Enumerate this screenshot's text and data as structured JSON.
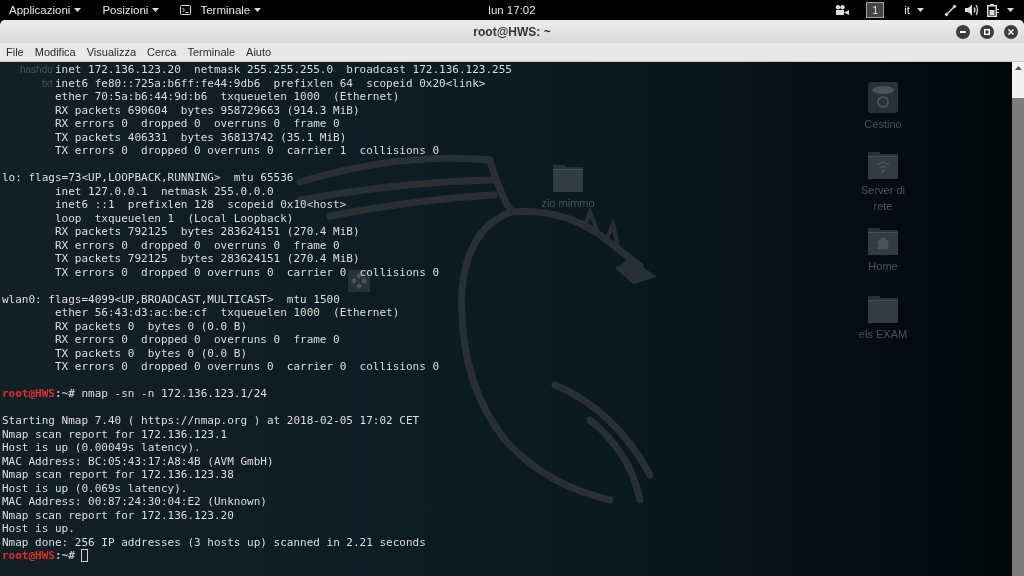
{
  "top_bar": {
    "menus": [
      {
        "kind": "menu",
        "label": "Applicazioni"
      },
      {
        "kind": "menu",
        "label": "Posizioni"
      },
      {
        "kind": "app",
        "label": "Terminale"
      }
    ],
    "clock": "lun 17:02",
    "workspace": "1",
    "keyboard_layout": "it"
  },
  "window": {
    "title": "root@HWS: ~"
  },
  "menu_bar": [
    "File",
    "Modifica",
    "Visualizza",
    "Cerca",
    "Terminale",
    "Aiuto"
  ],
  "desktop": {
    "icons": [
      {
        "kind": "label",
        "label": "hashdu"
      },
      {
        "kind": "label",
        "label": "txt"
      },
      {
        "kind": "app"
      },
      {
        "kind": "folder",
        "label": "zio mimmo"
      },
      {
        "kind": "trash",
        "label": "Cestino"
      },
      {
        "kind": "network",
        "label": "Server di rete"
      },
      {
        "kind": "home",
        "label": "Home"
      },
      {
        "kind": "folder",
        "label": "els EXAM"
      }
    ]
  },
  "terminal": {
    "entries": [
      {
        "kind": "interface",
        "details": [
          "inet 172.136.123.20  netmask 255.255.255.0  broadcast 172.136.123.255",
          "inet6 fe80::725a:b6ff:fe44:9db6  prefixlen 64  scopeid 0x20<link>",
          "ether 70:5a:b6:44:9d:b6  txqueuelen 1000  (Ethernet)",
          "RX packets 690604  bytes 958729663 (914.3 MiB)",
          "RX errors 0  dropped 0  overruns 0  frame 0",
          "TX packets 406331  bytes 36813742 (35.1 MiB)",
          "TX errors 0  dropped 0 overruns 0  carrier 1  collisions 0"
        ]
      },
      {
        "kind": "interface",
        "header": "lo: flags=73<UP,LOOPBACK,RUNNING>  mtu 65536",
        "details": [
          "inet 127.0.0.1  netmask 255.0.0.0",
          "inet6 ::1  prefixlen 128  scopeid 0x10<host>",
          "loop  txqueuelen 1  (Local Loopback)",
          "RX packets 792125  bytes 283624151 (270.4 MiB)",
          "RX errors 0  dropped 0  overruns 0  frame 0",
          "TX packets 792125  bytes 283624151 (270.4 MiB)",
          "TX errors 0  dropped 0 overruns 0  carrier 0  collisions 0"
        ]
      },
      {
        "kind": "interface",
        "header": "wlan0: flags=4099<UP,BROADCAST,MULTICAST>  mtu 1500",
        "details": [
          "ether 56:43:d3:ac:be:cf  txqueuelen 1000  (Ethernet)",
          "RX packets 0  bytes 0 (0.0 B)",
          "RX errors 0  dropped 0  overruns 0  frame 0",
          "TX packets 0  bytes 0 (0.0 B)",
          "TX errors 0  dropped 0 overruns 0  carrier 0  collisions 0"
        ]
      },
      {
        "kind": "prompt",
        "user_host": "root@HWS",
        "path": ":~#",
        "command": "nmap -sn -n 172.136.123.1/24"
      },
      {
        "kind": "output",
        "lines": [
          "Starting Nmap 7.40 ( https://nmap.org ) at 2018-02-05 17:02 CET",
          "Nmap scan report for 172.136.123.1",
          "Host is up (0.00049s latency).",
          "MAC Address: BC:05:43:17:A8:4B (AVM GmbH)",
          "Nmap scan report for 172.136.123.38",
          "Host is up (0.069s latency).",
          "MAC Address: 00:87:24:30:04:E2 (Unknown)",
          "Nmap scan report for 172.136.123.20",
          "Host is up.",
          "Nmap done: 256 IP addresses (3 hosts up) scanned in 2.21 seconds"
        ]
      },
      {
        "kind": "prompt",
        "user_host": "root@HWS",
        "path": ":~#",
        "cursor": true
      }
    ]
  }
}
